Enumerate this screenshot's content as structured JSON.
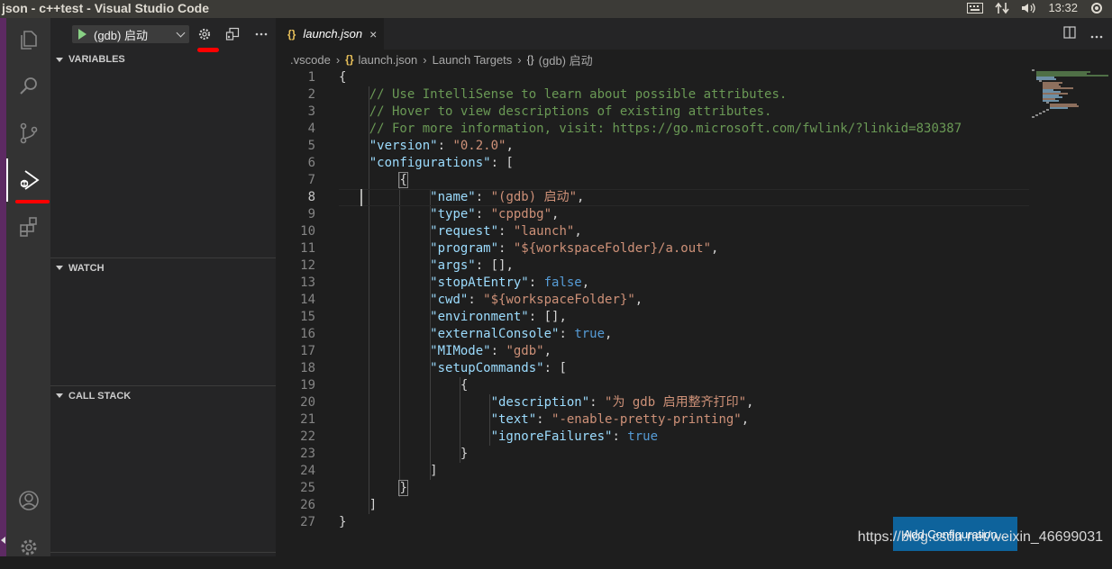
{
  "window": {
    "title": "json - c++test - Visual Studio Code",
    "time": "13:32"
  },
  "activity_bar": {
    "items": [
      "explorer-icon",
      "search-icon",
      "source-control-icon",
      "run-debug-icon",
      "extensions-icon"
    ],
    "bottom": [
      "account-icon",
      "manage-gear-icon"
    ],
    "active": "run-debug-icon"
  },
  "debug": {
    "config_label": "(gdb) 启动",
    "sections": {
      "variables": "VARIABLES",
      "watch": "WATCH",
      "call_stack": "CALL STACK"
    }
  },
  "tab": {
    "icon": "{}",
    "label": "launch.json",
    "close": "×"
  },
  "breadcrumb": {
    "parts": [
      ".vscode",
      "launch.json",
      "Launch Targets",
      "(gdb) 启动"
    ],
    "sep": "›",
    "json_icon": "{}",
    "object_icon": "{}"
  },
  "code_lines": [
    {
      "n": "1"
    },
    {
      "n": "2"
    },
    {
      "n": "3"
    },
    {
      "n": "4"
    },
    {
      "n": "5"
    },
    {
      "n": "6"
    },
    {
      "n": "7"
    },
    {
      "n": "8"
    },
    {
      "n": "9"
    },
    {
      "n": "10"
    },
    {
      "n": "11"
    },
    {
      "n": "12"
    },
    {
      "n": "13"
    },
    {
      "n": "14"
    },
    {
      "n": "15"
    },
    {
      "n": "16"
    },
    {
      "n": "17"
    },
    {
      "n": "18"
    },
    {
      "n": "19"
    },
    {
      "n": "20"
    },
    {
      "n": "21"
    },
    {
      "n": "22"
    },
    {
      "n": "23"
    },
    {
      "n": "24"
    },
    {
      "n": "25"
    },
    {
      "n": "26"
    },
    {
      "n": "27"
    }
  ],
  "code": {
    "l1": "{",
    "l2": "// Use IntelliSense to learn about possible attributes.",
    "l3": "// Hover to view descriptions of existing attributes.",
    "l4": "// For more information, visit: https://go.microsoft.com/fwlink/?linkid=830387",
    "k5": "\"version\"",
    "v5": "\"0.2.0\"",
    "k6": "\"configurations\"",
    "l7": "{",
    "k8": "\"name\"",
    "v8": "\"(gdb) 启动\"",
    "k9": "\"type\"",
    "v9": "\"cppdbg\"",
    "k10": "\"request\"",
    "v10": "\"launch\"",
    "k11": "\"program\"",
    "v11": "\"${workspaceFolder}/a.out\"",
    "k12": "\"args\"",
    "k13": "\"stopAtEntry\"",
    "v13": "false",
    "k14": "\"cwd\"",
    "v14": "\"${workspaceFolder}\"",
    "k15": "\"environment\"",
    "k16": "\"externalConsole\"",
    "v16": "true",
    "k17": "\"MIMode\"",
    "v17": "\"gdb\"",
    "k18": "\"setupCommands\"",
    "l19": "{",
    "k20": "\"description\"",
    "v20": "\"为 gdb 启用整齐打印\"",
    "k21": "\"text\"",
    "v21": "\"-enable-pretty-printing\"",
    "k22": "\"ignoreFailures\"",
    "v22": "true",
    "l23": "}",
    "l24": "]",
    "l25": "}",
    "l26": "]",
    "l27": "}"
  },
  "button": {
    "add_configuration": "Add Configuration..."
  },
  "watermark": "https://blog.csdn.net/weixin_46699031",
  "colors": {
    "accent": "#0e639c",
    "annotation": "#ff0000",
    "key": "#9cdcfe",
    "string": "#ce9178",
    "comment": "#6a9955",
    "keyword": "#569cd6"
  }
}
